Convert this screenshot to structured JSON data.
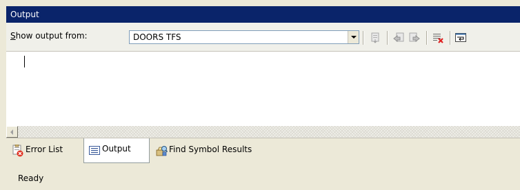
{
  "window": {
    "title": "Output"
  },
  "toolbar": {
    "show_output_from_prefix_underlined": "S",
    "show_output_from_rest": "how output from:",
    "source_selected": "DOORS TFS",
    "icons": [
      "goto-location-icon",
      "previous-message-icon",
      "next-message-icon",
      "clear-all-icon",
      "toggle-word-wrap-icon"
    ]
  },
  "tabs": [
    {
      "label": "Error List",
      "icon": "error-list-icon",
      "active": false
    },
    {
      "label": "Output",
      "icon": "output-icon",
      "active": true
    },
    {
      "label": "Find Symbol Results",
      "icon": "find-symbol-icon",
      "active": false
    }
  ],
  "status": {
    "text": "Ready"
  },
  "colors": {
    "title_bar": "#0a246a",
    "title_text": "#ffffff",
    "panel_bg": "#ece9d8",
    "text_area_bg": "#ffffff",
    "clear_x_red": "#e02020"
  }
}
